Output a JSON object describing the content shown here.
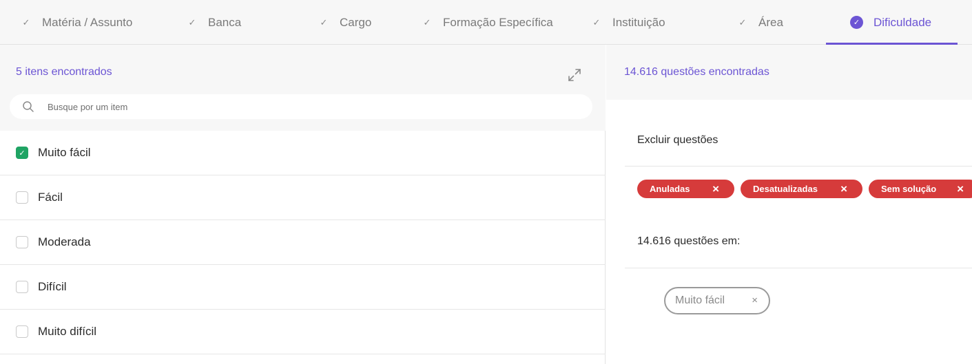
{
  "tabs": [
    {
      "label": "Matéria / Assunto",
      "icon": "check-icon"
    },
    {
      "label": "Banca",
      "icon": "check-icon"
    },
    {
      "label": "Cargo",
      "icon": "check-icon"
    },
    {
      "label": "Formação Específica",
      "icon": "check-icon"
    },
    {
      "label": "Instituição",
      "icon": "check-icon"
    },
    {
      "label": "Área",
      "icon": "check-icon"
    },
    {
      "label": "Dificuldade",
      "icon": "check-circle-icon",
      "active": true
    }
  ],
  "left": {
    "count_text": "5 itens encontrados",
    "search_placeholder": "Busque por um item",
    "items": [
      {
        "label": "Muito fácil",
        "checked": true
      },
      {
        "label": "Fácil",
        "checked": false
      },
      {
        "label": "Moderada",
        "checked": false
      },
      {
        "label": "Difícil",
        "checked": false
      },
      {
        "label": "Muito difícil",
        "checked": false
      }
    ]
  },
  "right": {
    "count_text": "14.616 questões encontradas",
    "exclude_title": "Excluir questões",
    "exclude_chips": [
      {
        "label": "Anuladas",
        "close": "×"
      },
      {
        "label": "Desatualizadas",
        "close": "×"
      },
      {
        "label": "Sem solução",
        "close": "×"
      }
    ],
    "in_title": "14.616 questões em:",
    "selected_chip": {
      "label": "Muito fácil",
      "close": "×"
    }
  },
  "colors": {
    "accent": "#6c55d4",
    "checkbox_checked": "#1fa464",
    "chip_red": "#d63b3b"
  }
}
